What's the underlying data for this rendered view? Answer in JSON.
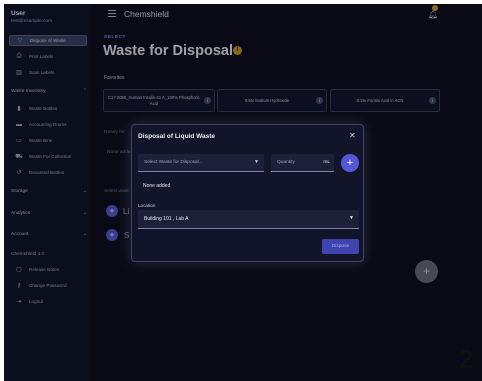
{
  "user": {
    "name": "User",
    "email": "test@example.com"
  },
  "sidebar": {
    "top_items": [
      {
        "label": "Dispose of Waste",
        "icon": "filter-icon",
        "active": true
      },
      {
        "label": "Print Labels",
        "icon": "printer-icon"
      },
      {
        "label": "Scan Labels",
        "icon": "barcode-icon"
      }
    ],
    "waste_inventory": {
      "label": "Waste Inventory",
      "items": [
        {
          "label": "Waste Bottles",
          "icon": "bottle-icon"
        },
        {
          "label": "Accounting Drums",
          "icon": "drum-icon"
        },
        {
          "label": "Waste Bins",
          "icon": "bin-icon"
        },
        {
          "label": "Waste For Collection",
          "icon": "truck-icon"
        },
        {
          "label": "Decanted Bottles",
          "icon": "undo-icon"
        }
      ]
    },
    "sections": [
      "Storage",
      "Analytics",
      "Account"
    ],
    "footer_title": "Chemshield 4.0",
    "footer_items": [
      {
        "label": "Release Notes",
        "icon": "notes-icon"
      },
      {
        "label": "Change Password",
        "icon": "key-icon"
      },
      {
        "label": "Logout",
        "icon": "logout-icon"
      }
    ]
  },
  "header": {
    "app_name": "Chemshield",
    "menu_icon": "hamburger-icon",
    "bell_icon": "bell-icon"
  },
  "page": {
    "overline": "SELECT",
    "title": "Waste for Disposal",
    "title_icon": "info-icon",
    "favorites_label": "Favorites",
    "favorites": [
      "C17 2080_Human Insulin 61 A_100% Phosphoric Acid",
      "0.5N Sodium Hydroxide",
      "0.1% Formic Acid in ACN"
    ],
    "bg_ready_label": "Ready for",
    "bg_none_added": "None adde",
    "bg_select_label": "Select wast",
    "bg_letter_1": "Li",
    "bg_letter_2": "S"
  },
  "dialog": {
    "title": "Disposal of Liquid Waste",
    "waste_select_placeholder": "Select Waste for Disposal...",
    "quantity_placeholder": "Quantity",
    "quantity_unit": "mL",
    "none_added": "None added",
    "location_label": "Location",
    "location_value": "Building 101 , Lab A",
    "dispose_label": "Dispose"
  },
  "page_number": "2",
  "colors": {
    "accent": "#5458d6",
    "warning": "#d99a1d",
    "overline": "#8a91ff"
  }
}
